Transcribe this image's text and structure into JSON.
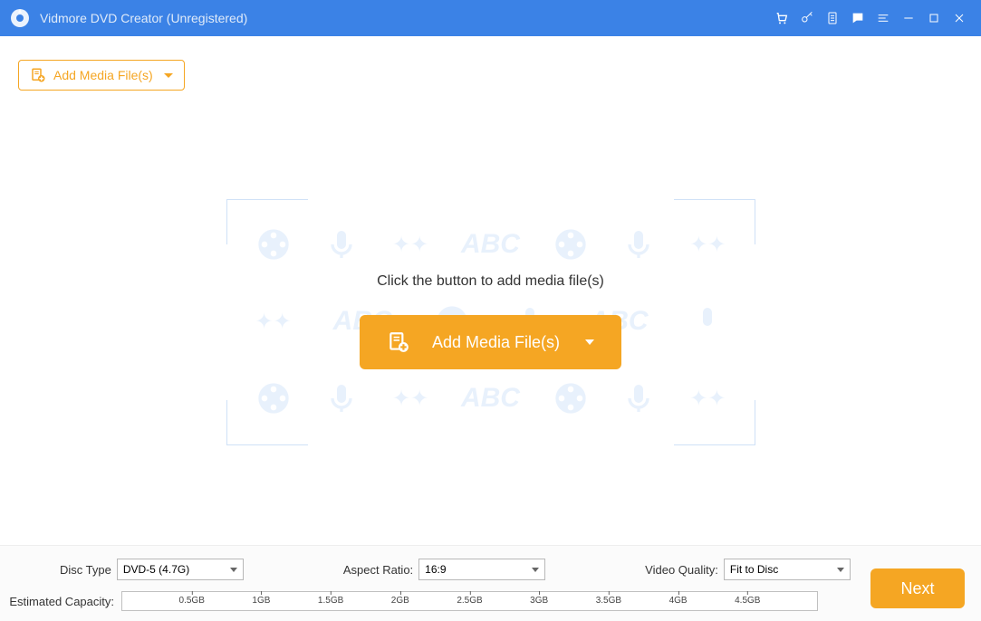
{
  "titlebar": {
    "title": "Vidmore DVD Creator (Unregistered)"
  },
  "toolbar": {
    "add_small_label": "Add Media File(s)"
  },
  "main": {
    "prompt": "Click the button to add media file(s)",
    "add_big_label": "Add Media File(s)"
  },
  "bottom": {
    "disc_type_label": "Disc Type",
    "disc_type_value": "DVD-5 (4.7G)",
    "aspect_label": "Aspect Ratio:",
    "aspect_value": "16:9",
    "quality_label": "Video Quality:",
    "quality_value": "Fit to Disc",
    "capacity_label": "Estimated Capacity:",
    "capacity_ticks": [
      "0.5GB",
      "1GB",
      "1.5GB",
      "2GB",
      "2.5GB",
      "3GB",
      "3.5GB",
      "4GB",
      "4.5GB"
    ],
    "next_label": "Next"
  },
  "bg_text": {
    "abc": "ABC"
  }
}
